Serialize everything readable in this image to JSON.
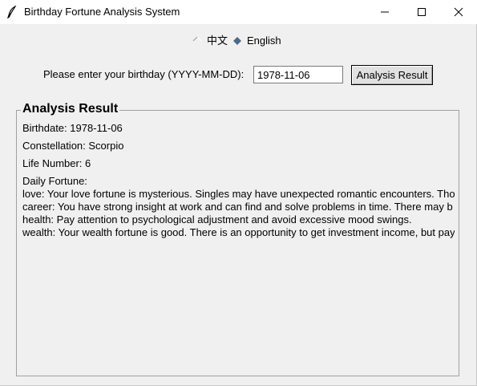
{
  "window": {
    "title": "Birthday Fortune Analysis System",
    "icon": "feather-icon",
    "controls": [
      "minimize-icon",
      "maximize-icon",
      "close-icon"
    ]
  },
  "language": {
    "options": [
      {
        "label": "中文",
        "selected": false
      },
      {
        "label": "English",
        "selected": true
      }
    ]
  },
  "form": {
    "label": "Please enter your birthday (YYYY-MM-DD):",
    "birthday_value": "1978-11-06",
    "button_label": "Analysis Result"
  },
  "result": {
    "title": "Analysis Result",
    "birthdate": "Birthdate: 1978-11-06",
    "constellation": "Constellation: Scorpio",
    "life_number": "Life Number: 6",
    "daily_fortune_heading": "Daily Fortune:",
    "fortunes": [
      "love: Your love fortune is mysterious. Singles may have unexpected romantic encounters. Tho",
      "career: You have strong insight at work and can find and solve problems in time. There may b",
      "health: Pay attention to psychological adjustment and avoid excessive mood swings.",
      "wealth: Your wealth fortune is good. There is an opportunity to get investment income, but pay"
    ]
  }
}
